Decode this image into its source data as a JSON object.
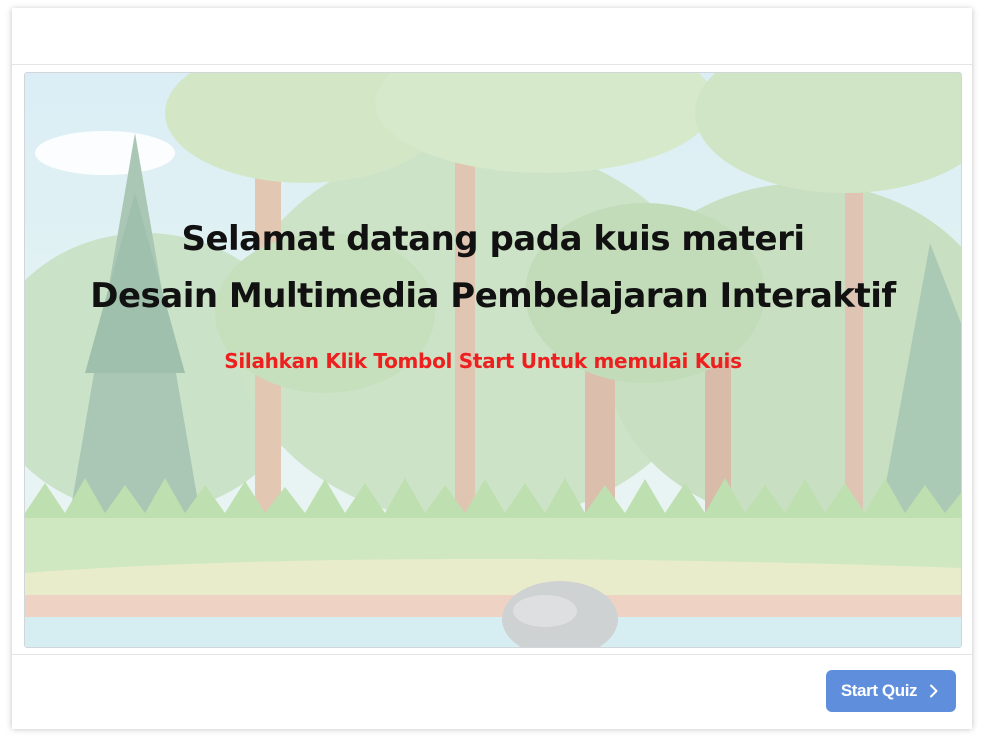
{
  "slide": {
    "title_line1": "Selamat datang pada kuis materi",
    "title_line2": "Desain Multimedia Pembelajaran Interaktif",
    "subtitle": "Silahkan Klik Tombol Start Untuk memulai Kuis"
  },
  "footer": {
    "start_label": "Start Quiz",
    "start_icon": "chevron-right-icon"
  },
  "colors": {
    "title": "#111111",
    "subtitle": "#ee1f1f",
    "button": "#5f8fdc"
  }
}
